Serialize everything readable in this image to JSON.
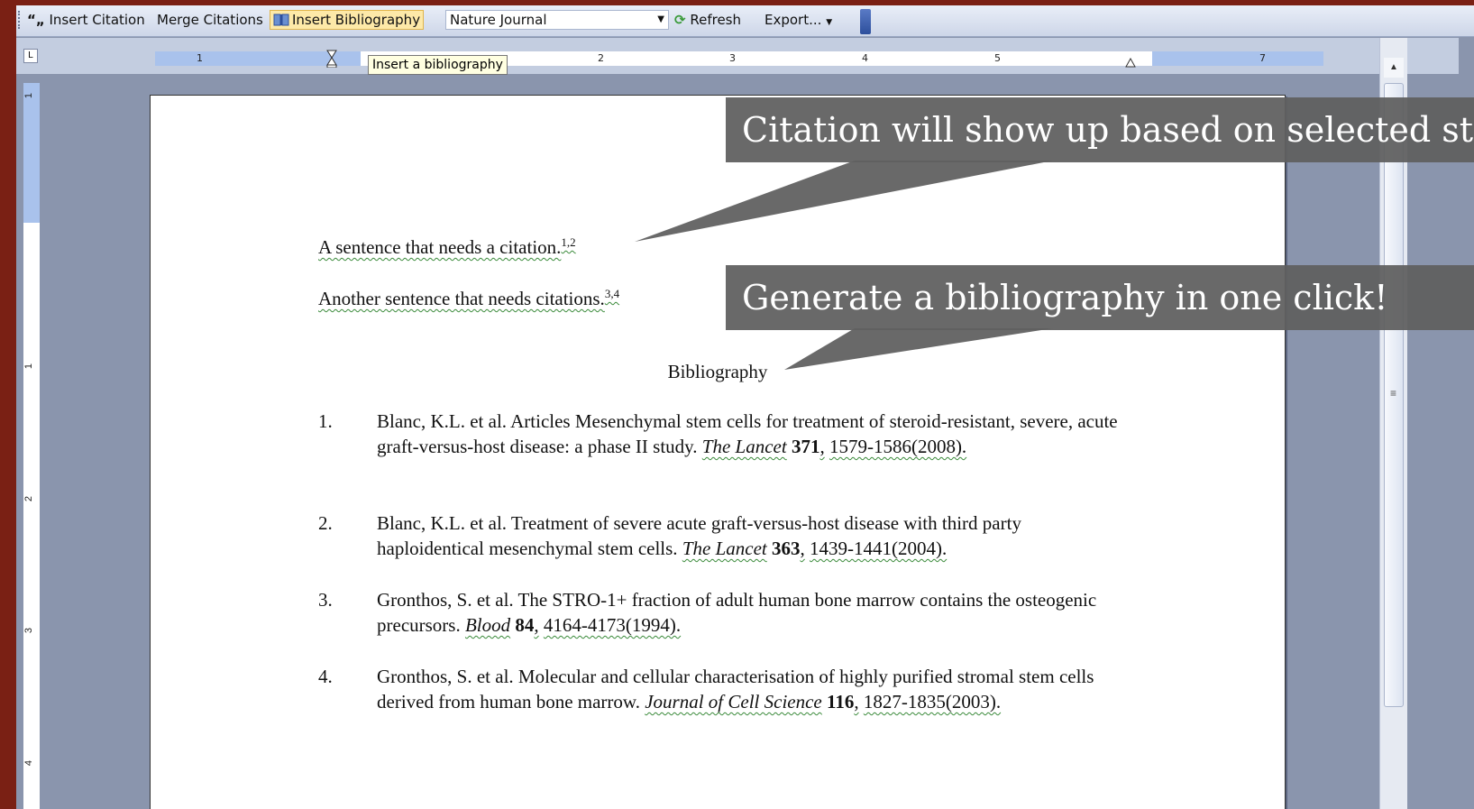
{
  "toolbar": {
    "insert_citation": "Insert Citation",
    "merge_citations": "Merge Citations",
    "insert_bibliography": "Insert Bibliography",
    "style_value": "Nature Journal",
    "refresh": "Refresh",
    "export": "Export..."
  },
  "tooltip": "Insert a bibliography",
  "ruler": {
    "h_numbers": [
      "1",
      "2",
      "3",
      "4",
      "5",
      "7"
    ],
    "v_numbers": [
      "1",
      "1",
      "2",
      "3",
      "4"
    ]
  },
  "document": {
    "sentence1": "A sentence that needs a citation.",
    "sentence1_sup": "1,2",
    "sentence2": "Another sentence that needs citations.",
    "sentence2_sup": "3,4",
    "bibliography_title": "Bibliography",
    "references": [
      {
        "num": "1.",
        "authors": "Blanc, K.L. et al. Articles Mesenchymal stem cells for treatment of steroid-resistant, severe, acute graft-versus-host disease: a phase II study.",
        "journal": "The Lancet",
        "volume": "371",
        "pages": "1579-1586(2008)."
      },
      {
        "num": "2.",
        "authors": "Blanc, K.L. et al. Treatment of severe acute graft-versus-host disease with third party haploidentical mesenchymal stem cells.",
        "journal": "The Lancet",
        "volume": "363",
        "pages": "1439-1441(2004)."
      },
      {
        "num": "3.",
        "authors": "Gronthos, S. et al. The STRO-1+ fraction of adult human bone marrow contains the osteogenic precursors.",
        "journal": "Blood",
        "volume": "84",
        "pages": "4164-4173(1994)."
      },
      {
        "num": "4.",
        "authors": "Gronthos, S. et al. Molecular and cellular characterisation of highly purified stromal stem cells derived from human bone marrow.",
        "journal": "Journal of Cell Science",
        "volume": "116",
        "pages": "1827-1835(2003)."
      }
    ]
  },
  "callouts": {
    "citation": "Citation will show up based on selected st",
    "bibliography": "Generate a bibliography in one click!"
  },
  "colors": {
    "background": "#7a2014",
    "callout": "#606060",
    "highlight": "#fde9a8"
  }
}
